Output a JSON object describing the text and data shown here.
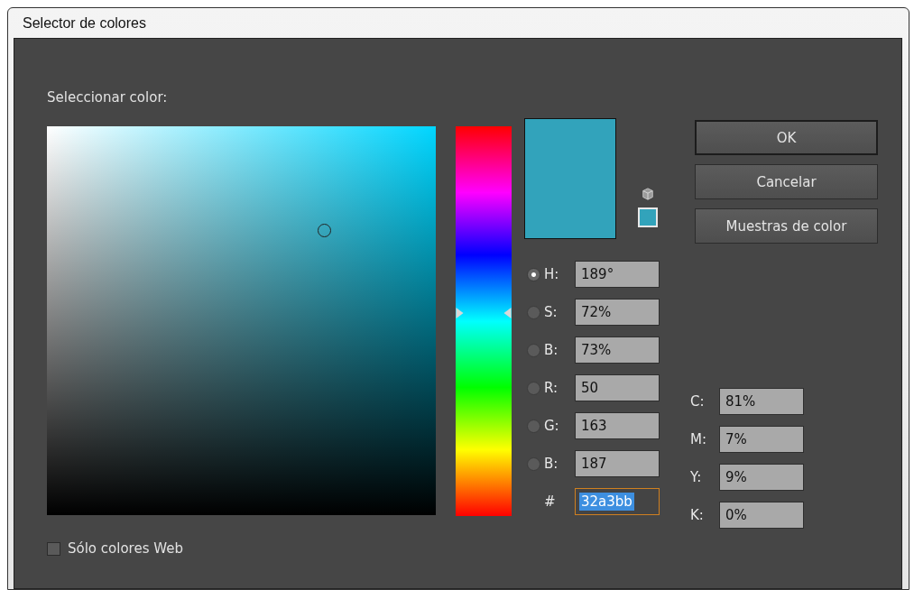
{
  "window": {
    "title": "Selector de colores"
  },
  "select_label": "Seleccionar color:",
  "hue_slider": {
    "level": 0.48
  },
  "fields": [
    {
      "label": "H:",
      "value": "189°",
      "selected": true
    },
    {
      "label": "S:",
      "value": "72%",
      "selected": false
    },
    {
      "label": "B:",
      "value": "73%",
      "selected": false
    },
    {
      "label": "R:",
      "value": "50",
      "selected": false
    },
    {
      "label": "G:",
      "value": "163",
      "selected": false
    },
    {
      "label": "B:",
      "value": "187",
      "selected": false
    }
  ],
  "hex": {
    "label": "#",
    "value": "32a3bb"
  },
  "cmyk": [
    {
      "label": "C:",
      "value": "81%"
    },
    {
      "label": "M:",
      "value": "7%"
    },
    {
      "label": "Y:",
      "value": "9%"
    },
    {
      "label": "K:",
      "value": "0%"
    }
  ],
  "buttons": [
    {
      "label": "OK",
      "default": true
    },
    {
      "label": "Cancelar",
      "default": false
    },
    {
      "label": "Muestras de color",
      "default": false
    }
  ],
  "web_only": {
    "label": "Sólo colores Web",
    "checked": false
  }
}
